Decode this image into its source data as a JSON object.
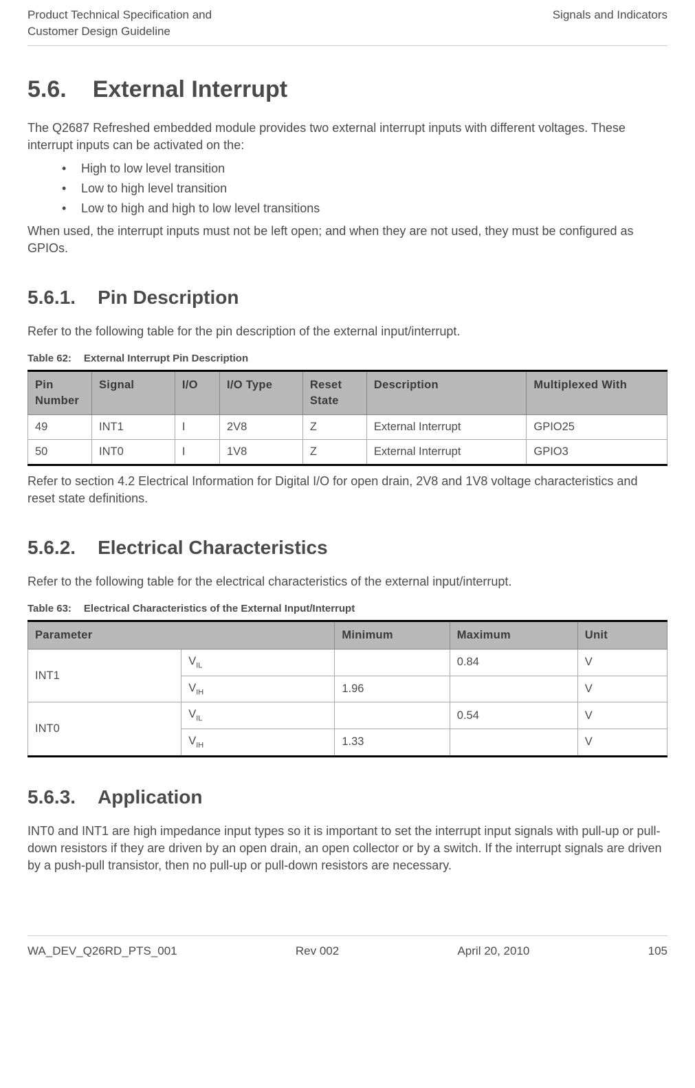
{
  "header": {
    "left_line1": "Product Technical Specification and",
    "left_line2": "Customer Design Guideline",
    "right": "Signals and Indicators"
  },
  "section5_6": {
    "number": "5.6.",
    "title": "External Interrupt",
    "intro_p1": "The Q2687 Refreshed embedded module provides two external interrupt inputs with different voltages. These interrupt inputs can be activated on the:",
    "bullets": [
      "High to low level transition",
      "Low to high level transition",
      "Low to high and high to low level transitions"
    ],
    "intro_p2": "When used, the interrupt inputs must not be left open; and when they are not used, they must be configured as GPIOs."
  },
  "section5_6_1": {
    "number": "5.6.1.",
    "title": "Pin Description",
    "intro": "Refer to the following table for the pin description of the external input/interrupt.",
    "table_caption_num": "Table 62:",
    "table_caption_title": "External Interrupt Pin Description",
    "headers": [
      "Pin Number",
      "Signal",
      "I/O",
      "I/O Type",
      "Reset State",
      "Description",
      "Multiplexed With"
    ],
    "rows": [
      [
        "49",
        "INT1",
        "I",
        "2V8",
        "Z",
        "External Interrupt",
        "GPIO25"
      ],
      [
        "50",
        "INT0",
        "I",
        "1V8",
        "Z",
        "External Interrupt",
        "GPIO3"
      ]
    ],
    "after": "Refer to section 4.2 Electrical Information for Digital I/O for open drain, 2V8 and 1V8 voltage characteristics and reset state definitions."
  },
  "section5_6_2": {
    "number": "5.6.2.",
    "title": "Electrical Characteristics",
    "intro": "Refer to the following table for the electrical characteristics of the external input/interrupt.",
    "table_caption_num": "Table 63:",
    "table_caption_title": "Electrical Characteristics of the External Input/Interrupt",
    "headers": [
      "Parameter",
      "Minimum",
      "Maximum",
      "Unit"
    ],
    "rows": [
      {
        "group": "INT1",
        "param_base": "V",
        "param_sub": "IL",
        "min": "",
        "max": "0.84",
        "unit": "V"
      },
      {
        "group": "INT1",
        "param_base": "V",
        "param_sub": "IH",
        "min": "1.96",
        "max": "",
        "unit": "V"
      },
      {
        "group": "INT0",
        "param_base": "V",
        "param_sub": "IL",
        "min": "",
        "max": "0.54",
        "unit": "V"
      },
      {
        "group": "INT0",
        "param_base": "V",
        "param_sub": "IH",
        "min": "1.33",
        "max": "",
        "unit": "V"
      }
    ]
  },
  "section5_6_3": {
    "number": "5.6.3.",
    "title": "Application",
    "body": "INT0 and INT1 are high impedance input types so it is important to set the interrupt input signals with pull-up or pull-down resistors if they are driven by an open drain, an open collector or by a switch. If the interrupt signals are driven by a push-pull transistor, then no pull-up or pull-down resistors are necessary."
  },
  "footer": {
    "doc_id": "WA_DEV_Q26RD_PTS_001",
    "rev": "Rev 002",
    "date": "April 20, 2010",
    "page": "105"
  }
}
